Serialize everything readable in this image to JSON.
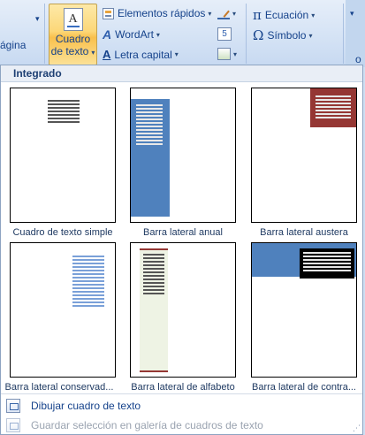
{
  "ribbon": {
    "partial_left_label": "ágina",
    "text_box_button": {
      "line1": "Cuadro",
      "line2": "de texto",
      "icon": "text-box-icon",
      "letter": "A"
    },
    "quick_parts": "Elementos rápidos",
    "wordart": "WordArt",
    "drop_cap": "Letra capital",
    "equation": "Ecuación",
    "symbol": "Símbolo",
    "partial_right_label": "o",
    "pi_glyph": "π",
    "omega_glyph": "Ω",
    "accent_color": "#f9c04c"
  },
  "gallery": {
    "header": "Integrado",
    "items": [
      {
        "label": "Cuadro de texto simple"
      },
      {
        "label": "Barra lateral anual",
        "color": "#4f81bd"
      },
      {
        "label": "Barra lateral austera",
        "color": "#953734"
      },
      {
        "label": "Barra lateral conservad..."
      },
      {
        "label": "Barra lateral de alfabeto",
        "color": "#eef3e4"
      },
      {
        "label": "Barra lateral de contra...",
        "color": "#4f81bd"
      }
    ]
  },
  "menu": {
    "draw_text_box": "Dibujar cuadro de texto",
    "save_selection": "Guardar selección en galería de cuadros de texto"
  }
}
